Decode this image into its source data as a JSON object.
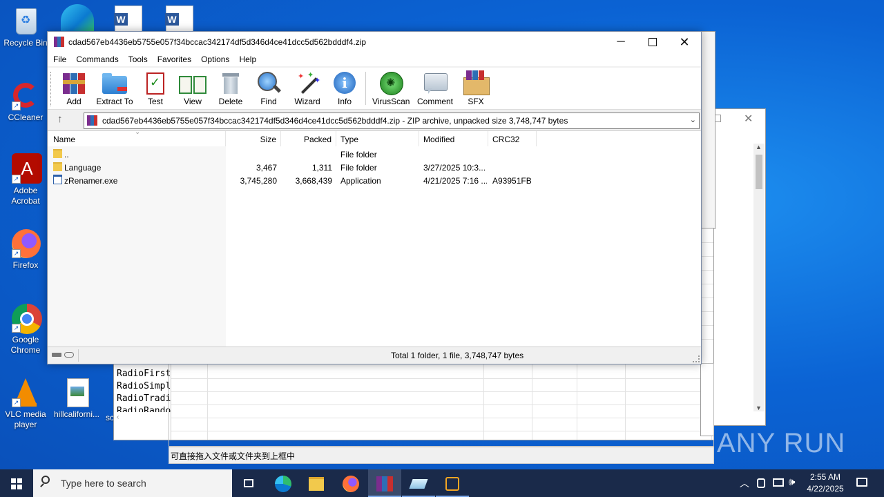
{
  "desktop": {
    "icons": [
      {
        "label": "Recycle Bin"
      },
      {
        "label": "CCleaner"
      },
      {
        "label": "Adobe Acrobat"
      },
      {
        "label": "Firefox"
      },
      {
        "label": "Google Chrome"
      },
      {
        "label": "VLC media player"
      },
      {
        "label": "hillcaliforni..."
      }
    ],
    "partial_label": "sc",
    "watermark": "ANY RUN"
  },
  "bg_window": {
    "list_items": [
      "RadioFirst",
      "RadioSimpl",
      "RadioTradi",
      "RadioRando"
    ],
    "status_text": "可直接拖入文件或文件夹到上框中"
  },
  "winrar": {
    "title": "cdad567eb4436eb5755e057f34bccac342174df5d346d4ce41dcc5d562bdddf4.zip",
    "menu": [
      "File",
      "Commands",
      "Tools",
      "Favorites",
      "Options",
      "Help"
    ],
    "toolbar": [
      "Add",
      "Extract To",
      "Test",
      "View",
      "Delete",
      "Find",
      "Wizard",
      "Info",
      "VirusScan",
      "Comment",
      "SFX"
    ],
    "address": "cdad567eb4436eb5755e057f34bccac342174df5d346d4ce41dcc5d562bdddf4.zip - ZIP archive, unpacked size 3,748,747 bytes",
    "columns": [
      "Name",
      "Size",
      "Packed",
      "Type",
      "Modified",
      "CRC32"
    ],
    "rows": [
      {
        "name": "..",
        "size": "",
        "packed": "",
        "type": "File folder",
        "modified": "",
        "crc": ""
      },
      {
        "name": "Language",
        "size": "3,467",
        "packed": "1,311",
        "type": "File folder",
        "modified": "3/27/2025 10:3...",
        "crc": ""
      },
      {
        "name": "zRenamer.exe",
        "size": "3,745,280",
        "packed": "3,668,439",
        "type": "Application",
        "modified": "4/21/2025 7:16 ...",
        "crc": "A93951FB"
      }
    ],
    "status": "Total 1 folder, 1 file, 3,748,747 bytes"
  },
  "taskbar": {
    "search_placeholder": "Type here to search",
    "time": "2:55 AM",
    "date": "4/22/2025"
  },
  "colors": {
    "accent": "#0b63d4",
    "taskbar": "#1a2a4a"
  }
}
